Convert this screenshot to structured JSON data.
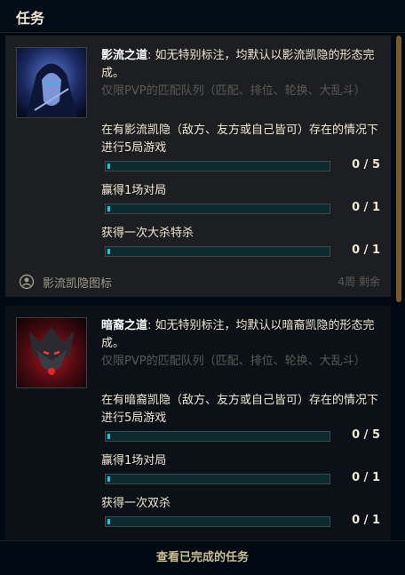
{
  "header": {
    "title": "任务"
  },
  "missions": [
    {
      "name": "影流之道",
      "description": ": 如无特别标注，均默认以影流凯隐的形态完成。",
      "restriction": "仅限PVP的匹配队列（匹配、排位、轮换、大乱斗）",
      "objectives": [
        {
          "text": "在有影流凯隐（敌方、友方或自己皆可）存在的情况下进行5局游戏",
          "progress": "0 / 5",
          "fraction": 0
        },
        {
          "text": "赢得1场对局",
          "progress": "0 / 1",
          "fraction": 0
        },
        {
          "text": "获得一次大杀特杀",
          "progress": "0 / 1",
          "fraction": 0
        }
      ],
      "reward": "影流凯隐图标",
      "time_left": "4周 剩余",
      "accent": "#3c5ac8"
    },
    {
      "name": "暗裔之道",
      "description": ": 如无特别标注，均默认以暗裔凯隐的形态完成。",
      "restriction": "仅限PVP的匹配队列（匹配、排位、轮换、大乱斗）",
      "objectives": [
        {
          "text": "在有暗裔凯隐（敌方、友方或自己皆可）存在的情况下进行5局游戏",
          "progress": "0 / 5",
          "fraction": 0
        },
        {
          "text": "赢得1场对局",
          "progress": "0 / 1",
          "fraction": 0
        },
        {
          "text": "获得一次双杀",
          "progress": "0 / 1",
          "fraction": 0
        }
      ],
      "accent": "#c81e28"
    }
  ],
  "footer": {
    "view_completed": "查看已完成的任务"
  },
  "colors": {
    "bar_fill": "#0acbe6",
    "bar_bg": "#0e2a2f",
    "gold": "#cdbe91",
    "scrollbar": "#785a28"
  }
}
